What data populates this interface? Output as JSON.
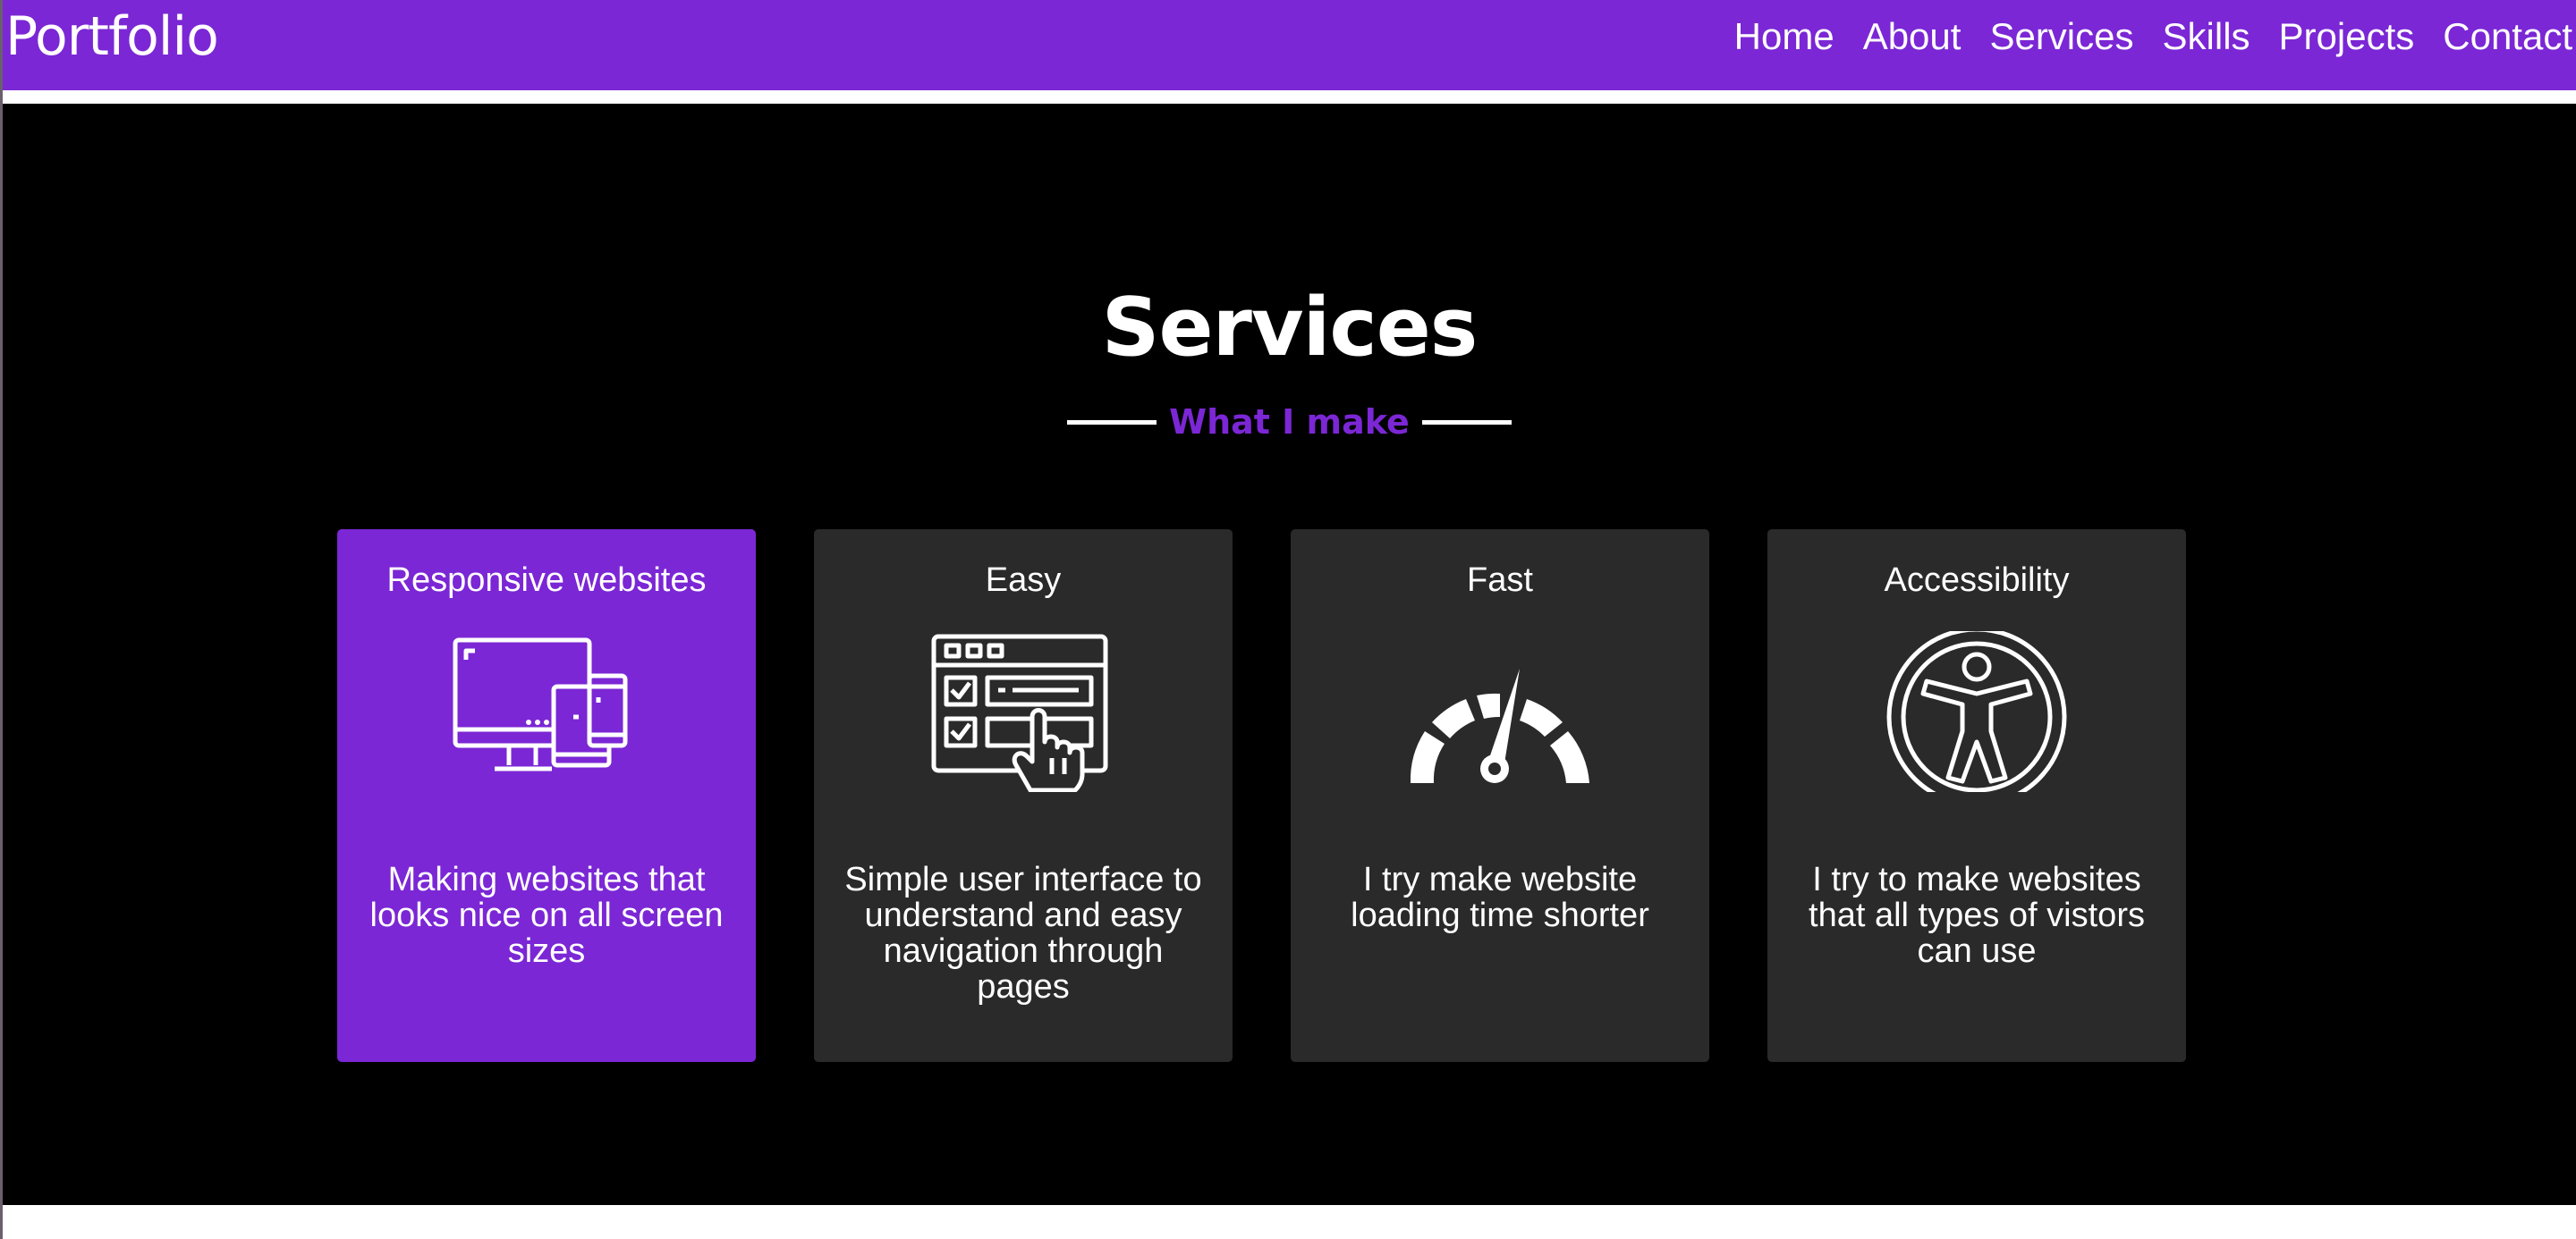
{
  "navbar": {
    "brand": "Portfolio",
    "links": [
      "Home",
      "About",
      "Services",
      "Skills",
      "Projects",
      "Contact"
    ]
  },
  "services": {
    "title": "Services",
    "subtitle": "What I make",
    "cards": [
      {
        "title": "Responsive websites",
        "text": "Making websites that looks nice on all screen sizes",
        "icon": "devices-icon"
      },
      {
        "title": "Easy",
        "text": "Simple user interface to understand and easy navigation through pages",
        "icon": "interface-click-icon"
      },
      {
        "title": "Fast",
        "text": "I try make website loading time shorter",
        "icon": "speedometer-icon"
      },
      {
        "title": "Accessibility",
        "text": "I try to make websites that all types of vistors can use",
        "icon": "accessibility-icon"
      }
    ]
  },
  "colors": {
    "accent": "#7b27d5",
    "card": "#2a2a2a",
    "background": "#000000",
    "text": "#ffffff"
  }
}
